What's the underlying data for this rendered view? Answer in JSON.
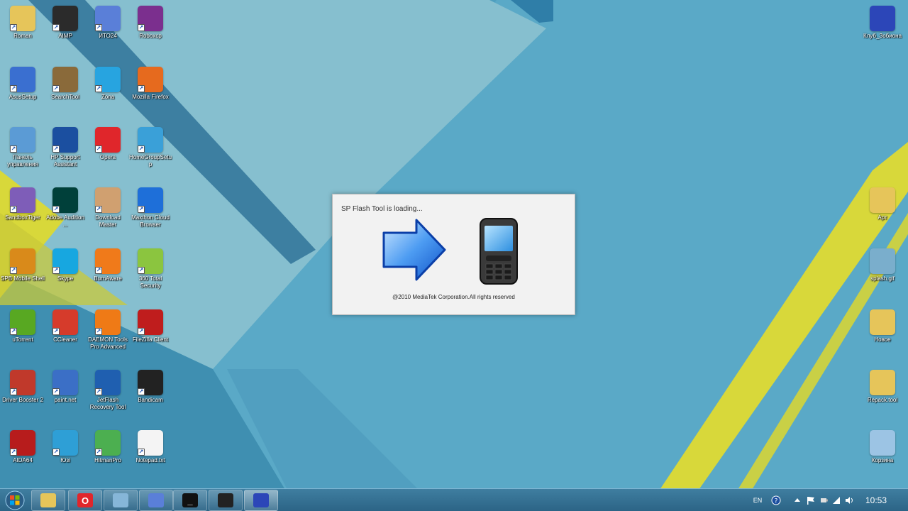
{
  "desktop": {
    "icons_left": [
      {
        "label": "Roman",
        "icon": "folder-icon",
        "color": "#e6c55a"
      },
      {
        "label": "AIMP",
        "icon": "aimp-icon",
        "color": "#2b2b2b"
      },
      {
        "label": "ИТО24",
        "icon": "floppy-icon",
        "color": "#5a7fd8"
      },
      {
        "label": "Roboxcp",
        "icon": "winrar-icon",
        "color": "#7b2f8e"
      },
      {
        "label": "AsusSetup",
        "icon": "computer-icon",
        "color": "#3a6fd0"
      },
      {
        "label": "SearchTool",
        "icon": "toolbox-icon",
        "color": "#8a6a3a"
      },
      {
        "label": "Zona",
        "icon": "zona-icon",
        "color": "#27a4e0"
      },
      {
        "label": "Mozilla Firefox",
        "icon": "firefox-icon",
        "color": "#e66a1e"
      },
      {
        "label": "Панель управления",
        "icon": "control-panel-icon",
        "color": "#5b9bd5"
      },
      {
        "label": "HP Support Assistant",
        "icon": "help-icon",
        "color": "#1b4fa0"
      },
      {
        "label": "Opera",
        "icon": "opera-icon",
        "color": "#e0262b"
      },
      {
        "label": "HomeGroupSetup",
        "icon": "network-icon",
        "color": "#3aa0d8"
      },
      {
        "label": "SandboxTiger",
        "icon": "windows-icon",
        "color": "#7e5db8"
      },
      {
        "label": "Adobe Audition ...",
        "icon": "audition-icon",
        "color": "#00403a"
      },
      {
        "label": "Download Master",
        "icon": "download-icon",
        "color": "#d0a070"
      },
      {
        "label": "Maxthon Cloud Browser",
        "icon": "maxthon-icon",
        "color": "#1e6fd9"
      },
      {
        "label": "SPB Mobile Shell",
        "icon": "link-icon",
        "color": "#d98a1a"
      },
      {
        "label": "Skype",
        "icon": "skype-icon",
        "color": "#17a7e0"
      },
      {
        "label": "BurnAware",
        "icon": "burn-icon",
        "color": "#f07a1a"
      },
      {
        "label": "360 Total Security",
        "icon": "security-icon",
        "color": "#8bc53f"
      },
      {
        "label": "uTorrent",
        "icon": "utorrent-icon",
        "color": "#58a822"
      },
      {
        "label": "CCleaner",
        "icon": "ccleaner-icon",
        "color": "#d63b2b"
      },
      {
        "label": "DAEMON Tools Pro Advanced",
        "icon": "daemon-icon",
        "color": "#ef7a16"
      },
      {
        "label": "FileZilla Client",
        "icon": "filezilla-icon",
        "color": "#bf1d1d"
      },
      {
        "label": "Driver Booster 2",
        "icon": "booster-icon",
        "color": "#c0392b"
      },
      {
        "label": "paint.net",
        "icon": "paint-icon",
        "color": "#3b6fc6"
      },
      {
        "label": "JetFlash Recovery Tool",
        "icon": "jetflash-icon",
        "color": "#1f5fb0"
      },
      {
        "label": "Bandicam",
        "icon": "bandicam-icon",
        "color": "#222222"
      },
      {
        "label": "AIDA64",
        "icon": "aida64-icon",
        "color": "#b71c1c"
      },
      {
        "label": "Юзi",
        "icon": "bird-icon",
        "color": "#2e9fd6"
      },
      {
        "label": "HitmanPro",
        "icon": "hitman-icon",
        "color": "#4caf50"
      },
      {
        "label": "Notepad.txt",
        "icon": "document-icon",
        "color": "#f4f4f4"
      }
    ],
    "icons_right": [
      {
        "label": "Клуб_Зобиона",
        "icon": "redgate-icon",
        "color": "#2c46b8"
      },
      {
        "label": "Арт",
        "icon": "picture-folder-icon",
        "color": "#e6c55a"
      },
      {
        "label": "splash.gif",
        "icon": "gif-icon",
        "color": "#7aaecc"
      },
      {
        "label": "Новое",
        "icon": "folder-icon",
        "color": "#e6c55a"
      },
      {
        "label": "Repack.tool",
        "icon": "folder-icon",
        "color": "#e6c55a"
      },
      {
        "label": "Корзина",
        "icon": "recycle-bin-icon",
        "color": "#9cc4e4"
      }
    ]
  },
  "splash": {
    "title": "SP Flash Tool is loading...",
    "copyright": "@2010 MediaTek Corporation.All rights reserved"
  },
  "taskbar": {
    "buttons": [
      {
        "name": "explorer",
        "icon": "folder-icon",
        "color": "#e6c55a",
        "glyph": ""
      },
      {
        "name": "opera",
        "icon": "opera-icon",
        "color": "#e0262b",
        "glyph": "O"
      },
      {
        "name": "notepad",
        "icon": "pen-icon",
        "color": "#86b6d8",
        "glyph": ""
      },
      {
        "name": "floppy",
        "icon": "floppy-icon",
        "color": "#5a7fd8",
        "glyph": ""
      },
      {
        "name": "console",
        "icon": "console-icon",
        "color": "#111111",
        "glyph": "_"
      },
      {
        "name": "bandicam",
        "icon": "bandicam-icon",
        "color": "#222222",
        "glyph": ""
      },
      {
        "name": "flash-tool",
        "icon": "flash-tool-icon",
        "color": "#2c46b8",
        "glyph": ""
      }
    ],
    "tray": {
      "language": "EN",
      "clock": "10:53"
    }
  },
  "colors": {
    "wallpaper_base": "#4e9fbf",
    "accent_yellow": "#d8d83a",
    "taskbar": "#2c6486"
  }
}
